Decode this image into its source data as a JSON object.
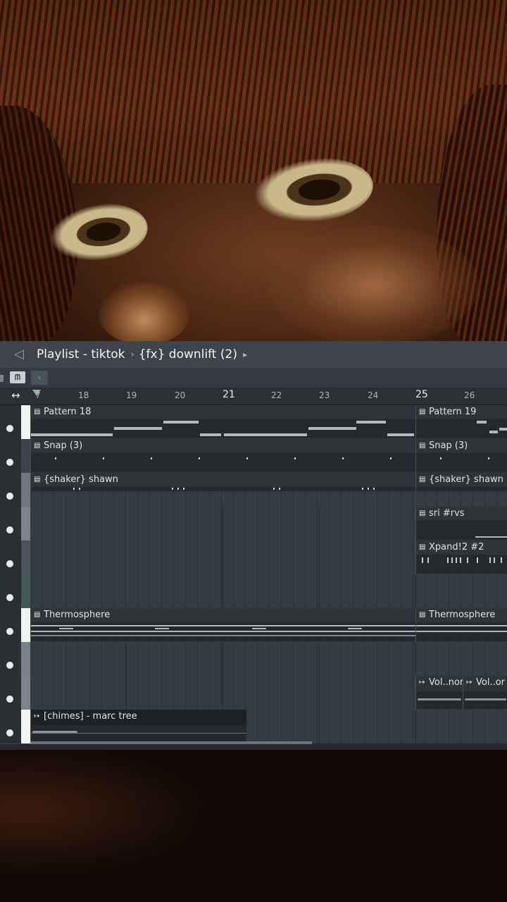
{
  "window": {
    "title": "Playlist - tiktok",
    "separator": "›",
    "pattern": "{fx} downlift (2)",
    "dropdown_arrow": "▸"
  },
  "icons": {
    "speaker": "speaker-icon",
    "piano": "piano-roll-icon",
    "scroll_left": "chevron-left-icon",
    "horizontal_zoom": "resize-horizontal-icon",
    "pattern": "pattern-clip-icon",
    "audio": "audio-clip-icon"
  },
  "toolbar": {
    "piano_glyph": "ᗰ",
    "left_glyph": "‹",
    "hz_glyph": "↔"
  },
  "ruler": {
    "numbers": [
      "7",
      "18",
      "19",
      "20",
      "21",
      "22",
      "23",
      "24",
      "25",
      "26"
    ],
    "emphasized": [
      "21",
      "25"
    ]
  },
  "tracks": [
    {
      "color": "#f1f2f2",
      "clips": [
        {
          "icon": "▤",
          "label": "Pattern 18"
        },
        {
          "icon": "▤",
          "label": "Pattern 19"
        }
      ]
    },
    {
      "color": "#3d4449",
      "clips": [
        {
          "icon": "▤",
          "label": "Snap (3)"
        },
        {
          "icon": "▤",
          "label": "Snap (3)"
        }
      ]
    },
    {
      "color": "#6f777c",
      "clips": [
        {
          "icon": "▤",
          "label": "{shaker} shawn"
        },
        {
          "icon": "▤",
          "label": "{shaker} shawn"
        }
      ]
    },
    {
      "color": "#7c8489",
      "clips": [
        {
          "icon": "▤",
          "label": "sri #rvs"
        }
      ]
    },
    {
      "color": "#495257",
      "clips": [
        {
          "icon": "▤",
          "label": "Xpand!2 #2"
        }
      ]
    },
    {
      "color": "#3f5856",
      "clips": []
    },
    {
      "color": "#f1f2f2",
      "clips": [
        {
          "icon": "▤",
          "label": "Thermosphere"
        },
        {
          "icon": "▤",
          "label": "Thermosphere"
        }
      ]
    },
    {
      "color": "#7a8287",
      "clips": []
    },
    {
      "color": "#7c8489",
      "clips": [
        {
          "icon": "↦",
          "label": "Vol..nor"
        },
        {
          "icon": "↦",
          "label": "Vol..or"
        }
      ]
    },
    {
      "color": "#f1f2f2",
      "clips": [
        {
          "icon": "↦",
          "label": "[chimes] - marc tree"
        }
      ]
    }
  ]
}
